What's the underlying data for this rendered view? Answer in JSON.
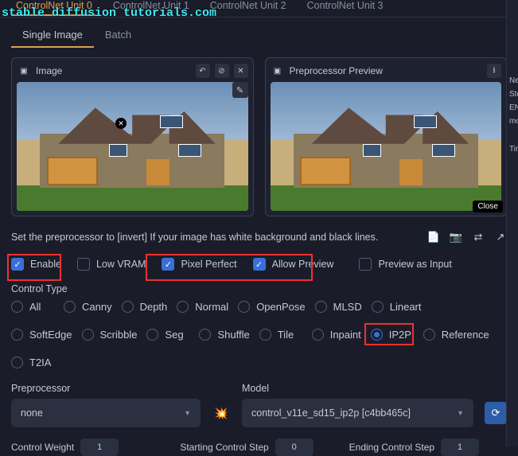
{
  "watermark": "stable diffusion tutorials.com",
  "unit_tabs": {
    "u0": "ControlNet Unit 0",
    "u1": "ControlNet Unit 1",
    "u2": "ControlNet Unit 2",
    "u3": "ControlNet Unit 3"
  },
  "sub_tabs": {
    "single": "Single Image",
    "batch": "Batch"
  },
  "panels": {
    "image_label": "Image",
    "preview_label": "Preprocessor Preview",
    "close_label": "Close"
  },
  "hint": "Set the preprocessor to [invert] If your image has white background and black lines.",
  "checks": {
    "enable": "Enable",
    "low_vram": "Low VRAM",
    "pixel_perfect": "Pixel Perfect",
    "allow_preview": "Allow Preview",
    "preview_as_input": "Preview as Input"
  },
  "control_type_label": "Control Type",
  "radios": {
    "all": "All",
    "canny": "Canny",
    "depth": "Depth",
    "normal": "Normal",
    "openpose": "OpenPose",
    "mlsd": "MLSD",
    "lineart": "Lineart",
    "softedge": "SoftEdge",
    "scribble": "Scribble",
    "seg": "Seg",
    "shuffle": "Shuffle",
    "tile": "Tile",
    "inpaint": "Inpaint",
    "ip2p": "IP2P",
    "reference": "Reference",
    "t2ia": "T2IA"
  },
  "preprocessor": {
    "label": "Preprocessor",
    "value": "none"
  },
  "model": {
    "label": "Model",
    "value": "control_v11e_sd15_ip2p [c4bb465c]"
  },
  "sliders": {
    "weight_label": "Control Weight",
    "weight_val": "1",
    "start_label": "Starting Control Step",
    "start_val": "0",
    "end_label": "Ending Control Step",
    "end_val": "1"
  },
  "right": {
    "ne": "Ne",
    "ste": "Ste",
    "en": "EN",
    "mo": "mo",
    "tin": "Tin"
  }
}
